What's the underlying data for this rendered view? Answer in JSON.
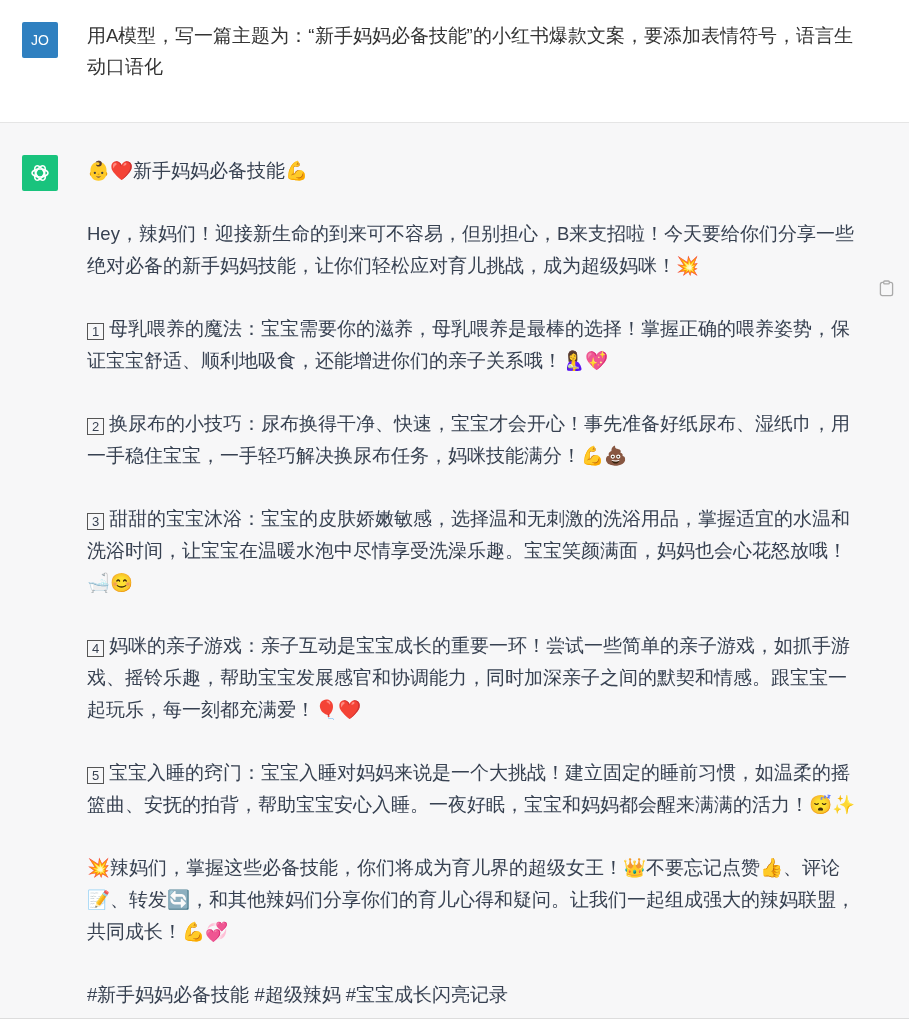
{
  "user_message": {
    "avatar": "JO",
    "text": "用A模型，写一篇主题为：“新手妈妈必备技能”的小红书爆款文案，要添加表情符号，语言生动口语化"
  },
  "assistant_message": {
    "paragraphs": [
      {
        "text": "👶❤️新手妈妈必备技能💪"
      },
      {
        "text": "Hey，辣妈们！迎接新生命的到来可不容易，但别担心，B来支招啦！今天要给你们分享一些绝对必备的新手妈妈技能，让你们轻松应对育儿挑战，成为超级妈咪！💥"
      },
      {
        "number": "1",
        "text": "母乳喂养的魔法：宝宝需要你的滋养，母乳喂养是最棒的选择！掌握正确的喂养姿势，保证宝宝舒适、顺利地吸食，还能增进你们的亲子关系哦！🤱💖"
      },
      {
        "number": "2",
        "text": "换尿布的小技巧：尿布换得干净、快速，宝宝才会开心！事先准备好纸尿布、湿纸巾，用一手稳住宝宝，一手轻巧解决换尿布任务，妈咪技能满分！💪💩"
      },
      {
        "number": "3",
        "text": "甜甜的宝宝沐浴：宝宝的皮肤娇嫩敏感，选择温和无刺激的洗浴用品，掌握适宜的水温和洗浴时间，让宝宝在温暖水泡中尽情享受洗澡乐趣。宝宝笑颜满面，妈妈也会心花怒放哦！🛁😊"
      },
      {
        "number": "4",
        "text": "妈咪的亲子游戏：亲子互动是宝宝成长的重要一环！尝试一些简单的亲子游戏，如抓手游戏、摇铃乐趣，帮助宝宝发展感官和协调能力，同时加深亲子之间的默契和情感。跟宝宝一起玩乐，每一刻都充满爱！🎈❤️"
      },
      {
        "number": "5",
        "text": "宝宝入睡的窍门：宝宝入睡对妈妈来说是一个大挑战！建立固定的睡前习惯，如温柔的摇篮曲、安抚的拍背，帮助宝宝安心入睡。一夜好眠，宝宝和妈妈都会醒来满满的活力！😴✨"
      },
      {
        "text": "💥辣妈们，掌握这些必备技能，你们将成为育儿界的超级女王！👑不要忘记点赞👍、评论📝、转发🔄，和其他辣妈们分享你们的育儿心得和疑问。让我们一起组成强大的辣妈联盟，共同成长！💪💞"
      },
      {
        "text": "#新手妈妈必备技能 #超级辣妈 #宝宝成长闪亮记录"
      }
    ]
  }
}
